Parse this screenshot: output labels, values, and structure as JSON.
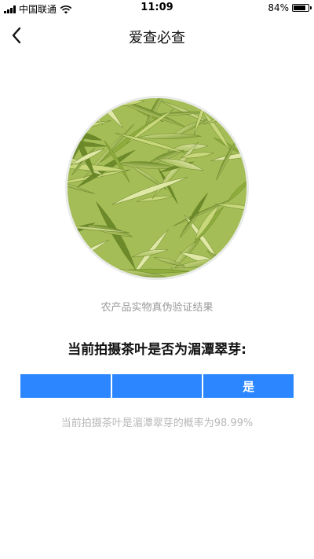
{
  "status_bar": {
    "carrier": "中国联通",
    "time": "11:09",
    "battery_text": "84%",
    "battery_level": 0.84
  },
  "nav": {
    "title": "爱查必查",
    "back_icon": "chevron-left-icon"
  },
  "main": {
    "caption": "农产品实物真伪验证结果",
    "question": "当前拍摄茶叶是否为湄潭翠芽:",
    "result_segments": [
      "",
      "",
      "是"
    ],
    "probability_text": "当前拍摄茶叶是湄潭翠芽的概率为98.99%"
  },
  "colors": {
    "accent": "#2b86ff",
    "caption": "#9a9a9a",
    "probability": "#b8b8b8"
  }
}
